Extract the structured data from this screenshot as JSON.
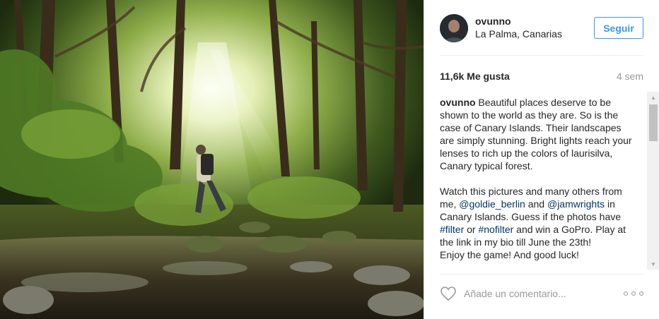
{
  "post": {
    "photo": {
      "description_icon": "forest-photo"
    },
    "header": {
      "username": "ovunno",
      "location": "La Palma, Canarias",
      "follow_label": "Seguir"
    },
    "stats": {
      "likes": "11,6k Me gusta",
      "age": "4 sem"
    },
    "caption": {
      "user": "ovunno",
      "para1": " Beautiful places deserve to be shown to the world as they are. So is the case of Canary Islands. Their landscapes are simply stunning. Bright lights reach your lenses to rich up the colors of laurisilva, Canary typical forest.",
      "para2_a": "Watch this pictures and many others from me, ",
      "mention1": "@goldie_berlin",
      "para2_b": " and ",
      "mention2": "@jamwrights",
      "para2_c": " in Canary Islands. Guess if the photos have ",
      "tag1": "#filter",
      "para2_d": " or ",
      "tag2": "#nofilter",
      "para2_e": " and win a GoPro. Play at the link in my bio till June the 23th!",
      "para3": "Enjoy the game! And good luck!"
    },
    "actions": {
      "comment_placeholder": "Añade un comentario...",
      "like_icon": "heart-icon",
      "more_icon": "more-options-icon"
    },
    "colors": {
      "accent": "#3897f0",
      "link": "#003569",
      "muted": "#999999"
    }
  }
}
